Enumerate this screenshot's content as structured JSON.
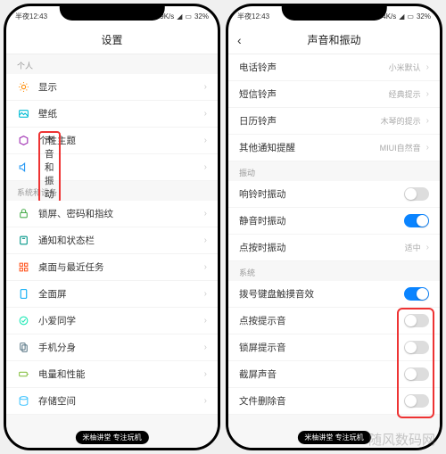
{
  "status": {
    "time": "半夜12:43",
    "net": "10.9K/s",
    "battery": "32%"
  },
  "status2": {
    "time": "半夜12:43",
    "net": "1.84K/s",
    "battery": "32%"
  },
  "left": {
    "title": "设置",
    "sec1": "个人",
    "items1": [
      "显示",
      "壁纸",
      "个性主题",
      "声音和振动"
    ],
    "sec2": "系统和设备",
    "items2": [
      "锁屏、密码和指纹",
      "通知和状态栏",
      "桌面与最近任务",
      "全面屏",
      "小爱同学",
      "手机分身",
      "电量和性能",
      "存储空间"
    ]
  },
  "right": {
    "title": "声音和振动",
    "top": [
      {
        "label": "电话铃声",
        "value": "小米默认"
      },
      {
        "label": "短信铃声",
        "value": "经典提示"
      },
      {
        "label": "日历铃声",
        "value": "木琴的提示"
      },
      {
        "label": "其他通知提醒",
        "value": "MIUI自然音"
      }
    ],
    "sec_vib": "振动",
    "vib": [
      {
        "label": "响铃时振动",
        "on": false,
        "toggle": true
      },
      {
        "label": "静音时振动",
        "on": true,
        "toggle": true
      },
      {
        "label": "点按时振动",
        "value": "适中",
        "toggle": false
      }
    ],
    "sec_sys": "系统",
    "sys": [
      {
        "label": "拨号键盘触摸音效",
        "on": true
      },
      {
        "label": "点按提示音",
        "on": false
      },
      {
        "label": "锁屏提示音",
        "on": false
      },
      {
        "label": "截屏声音",
        "on": false
      },
      {
        "label": "文件删除音",
        "on": false
      }
    ]
  },
  "navbar": "米柚讲堂 专注玩机",
  "watermark": "随风数码网",
  "chevron": "›",
  "back": "‹",
  "colors": {
    "orange": "#ff8a00",
    "cyan": "#00bcd4",
    "purple": "#9c27b0",
    "blue": "#2196f3",
    "green": "#4caf50",
    "teal": "#009688",
    "deeporange": "#ff5722",
    "lightblue": "#03a9f4",
    "mint": "#1de9b6",
    "grey": "#607d8b",
    "olive": "#8bc34a",
    "ltblue": "#40c4ff"
  }
}
